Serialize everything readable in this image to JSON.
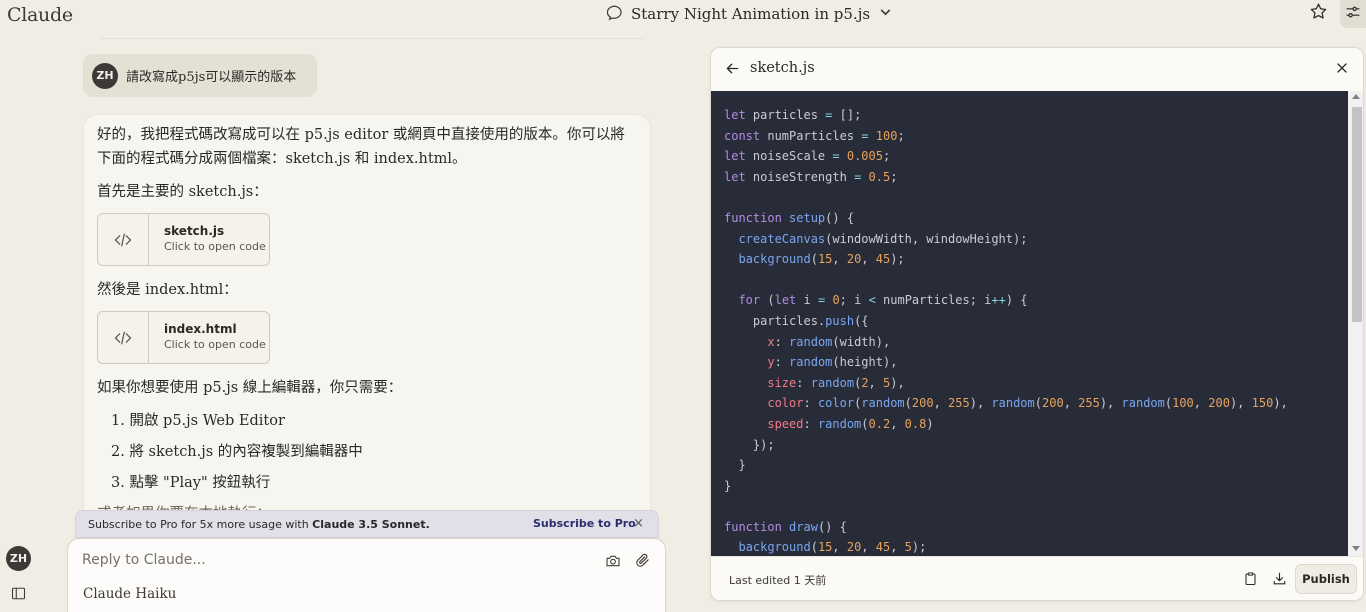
{
  "app": {
    "brand": "Claude"
  },
  "header": {
    "conversation_title": "Starry Night Animation in p5.js"
  },
  "user_message": {
    "avatar_initials": "ZH",
    "text": "請改寫成p5js可以顯示的版本"
  },
  "assistant_message": {
    "intro_line1": "好的，我把程式碼改寫成可以在 p5.js editor 或網頁中直接使用的版本。你可以將",
    "intro_line2": "下面的程式碼分成兩個檔案：sketch.js 和 index.html。",
    "first_label": "首先是主要的 sketch.js：",
    "artifact1": {
      "name": "sketch.js",
      "subtitle": "Click to open code"
    },
    "then_label": "然後是 index.html：",
    "artifact2": {
      "name": "index.html",
      "subtitle": "Click to open code"
    },
    "editor_intro": "如果你想要使用 p5.js 線上編輯器，你只需要：",
    "steps": [
      "1. 開啟 p5.js Web Editor",
      "2. 將 sketch.js 的內容複製到編輯器中",
      "3. 點擊 \"Play\" 按鈕執行"
    ],
    "trailing_cut": "或者如果你要在本地執行："
  },
  "banner": {
    "text_prefix": "Subscribe to Pro for 5x more usage with ",
    "text_model": "Claude 3.5 Sonnet.",
    "link": "Subscribe to Pro",
    "close": "×"
  },
  "composer": {
    "placeholder": "Reply to Claude...",
    "model": "Claude Haiku"
  },
  "sidebar": {
    "avatar_initials": "ZH"
  },
  "panel": {
    "title": "sketch.js",
    "last_edited": "Last edited 1 天前",
    "publish": "Publish",
    "code_lines": [
      [
        [
          "kw",
          "let"
        ],
        [
          "t",
          " particles "
        ],
        [
          "op",
          "="
        ],
        [
          "t",
          " [];"
        ]
      ],
      [
        [
          "kw",
          "const"
        ],
        [
          "t",
          " numParticles "
        ],
        [
          "op",
          "="
        ],
        [
          "t",
          " "
        ],
        [
          "num",
          "100"
        ],
        [
          "t",
          ";"
        ]
      ],
      [
        [
          "kw",
          "let"
        ],
        [
          "t",
          " noiseScale "
        ],
        [
          "op",
          "="
        ],
        [
          "t",
          " "
        ],
        [
          "num",
          "0.005"
        ],
        [
          "t",
          ";"
        ]
      ],
      [
        [
          "kw",
          "let"
        ],
        [
          "t",
          " noiseStrength "
        ],
        [
          "op",
          "="
        ],
        [
          "t",
          " "
        ],
        [
          "num",
          "0.5"
        ],
        [
          "t",
          ";"
        ]
      ],
      [
        [
          "t",
          ""
        ]
      ],
      [
        [
          "kw",
          "function"
        ],
        [
          "t",
          " "
        ],
        [
          "fn",
          "setup"
        ],
        [
          "t",
          "() {"
        ]
      ],
      [
        [
          "t",
          "  "
        ],
        [
          "fn",
          "createCanvas"
        ],
        [
          "t",
          "(windowWidth, windowHeight);"
        ]
      ],
      [
        [
          "t",
          "  "
        ],
        [
          "fn",
          "background"
        ],
        [
          "t",
          "("
        ],
        [
          "num",
          "15"
        ],
        [
          "t",
          ", "
        ],
        [
          "num",
          "20"
        ],
        [
          "t",
          ", "
        ],
        [
          "num",
          "45"
        ],
        [
          "t",
          ");"
        ]
      ],
      [
        [
          "t",
          ""
        ]
      ],
      [
        [
          "t",
          "  "
        ],
        [
          "kw",
          "for"
        ],
        [
          "t",
          " ("
        ],
        [
          "kw",
          "let"
        ],
        [
          "t",
          " i "
        ],
        [
          "op",
          "="
        ],
        [
          "t",
          " "
        ],
        [
          "num",
          "0"
        ],
        [
          "t",
          "; i "
        ],
        [
          "op",
          "<"
        ],
        [
          "t",
          " numParticles; i"
        ],
        [
          "op",
          "++"
        ],
        [
          "t",
          ") {"
        ]
      ],
      [
        [
          "t",
          "    particles."
        ],
        [
          "fn",
          "push"
        ],
        [
          "t",
          "({"
        ]
      ],
      [
        [
          "t",
          "      "
        ],
        [
          "prop",
          "x"
        ],
        [
          "t",
          ": "
        ],
        [
          "fn",
          "random"
        ],
        [
          "t",
          "(width),"
        ]
      ],
      [
        [
          "t",
          "      "
        ],
        [
          "prop",
          "y"
        ],
        [
          "t",
          ": "
        ],
        [
          "fn",
          "random"
        ],
        [
          "t",
          "(height),"
        ]
      ],
      [
        [
          "t",
          "      "
        ],
        [
          "prop",
          "size"
        ],
        [
          "t",
          ": "
        ],
        [
          "fn",
          "random"
        ],
        [
          "t",
          "("
        ],
        [
          "num",
          "2"
        ],
        [
          "t",
          ", "
        ],
        [
          "num",
          "5"
        ],
        [
          "t",
          "),"
        ]
      ],
      [
        [
          "t",
          "      "
        ],
        [
          "prop",
          "color"
        ],
        [
          "t",
          ": "
        ],
        [
          "fn",
          "color"
        ],
        [
          "t",
          "("
        ],
        [
          "fn",
          "random"
        ],
        [
          "t",
          "("
        ],
        [
          "num",
          "200"
        ],
        [
          "t",
          ", "
        ],
        [
          "num",
          "255"
        ],
        [
          "t",
          "), "
        ],
        [
          "fn",
          "random"
        ],
        [
          "t",
          "("
        ],
        [
          "num",
          "200"
        ],
        [
          "t",
          ", "
        ],
        [
          "num",
          "255"
        ],
        [
          "t",
          "), "
        ],
        [
          "fn",
          "random"
        ],
        [
          "t",
          "("
        ],
        [
          "num",
          "100"
        ],
        [
          "t",
          ", "
        ],
        [
          "num",
          "200"
        ],
        [
          "t",
          "), "
        ],
        [
          "num",
          "150"
        ],
        [
          "t",
          "),"
        ]
      ],
      [
        [
          "t",
          "      "
        ],
        [
          "prop",
          "speed"
        ],
        [
          "t",
          ": "
        ],
        [
          "fn",
          "random"
        ],
        [
          "t",
          "("
        ],
        [
          "num",
          "0.2"
        ],
        [
          "t",
          ", "
        ],
        [
          "num",
          "0.8"
        ],
        [
          "t",
          ")"
        ]
      ],
      [
        [
          "t",
          "    });"
        ]
      ],
      [
        [
          "t",
          "  }"
        ]
      ],
      [
        [
          "t",
          "}"
        ]
      ],
      [
        [
          "t",
          ""
        ]
      ],
      [
        [
          "kw",
          "function"
        ],
        [
          "t",
          " "
        ],
        [
          "fn",
          "draw"
        ],
        [
          "t",
          "() {"
        ]
      ],
      [
        [
          "t",
          "  "
        ],
        [
          "fn",
          "background"
        ],
        [
          "t",
          "("
        ],
        [
          "num",
          "15"
        ],
        [
          "t",
          ", "
        ],
        [
          "num",
          "20"
        ],
        [
          "t",
          ", "
        ],
        [
          "num",
          "45"
        ],
        [
          "t",
          ", "
        ],
        [
          "num",
          "5"
        ],
        [
          "t",
          ");"
        ]
      ]
    ]
  },
  "icons": {
    "chat": "chat-bubble-icon",
    "chevron": "chevron-down-icon",
    "star": "star-icon",
    "settings": "sliders-icon",
    "code": "code-brackets-icon",
    "camera": "camera-icon",
    "attach": "paperclip-icon",
    "sidebar": "sidebar-toggle-icon",
    "back": "arrow-left-icon",
    "close": "close-icon",
    "copy": "clipboard-icon",
    "download": "download-icon"
  },
  "colors": {
    "page_bg": "#f0ede5",
    "code_bg": "#282c38",
    "keyword": "#b18be6",
    "function": "#7aa6f0",
    "number": "#e6a15b",
    "property": "#f07a85"
  }
}
